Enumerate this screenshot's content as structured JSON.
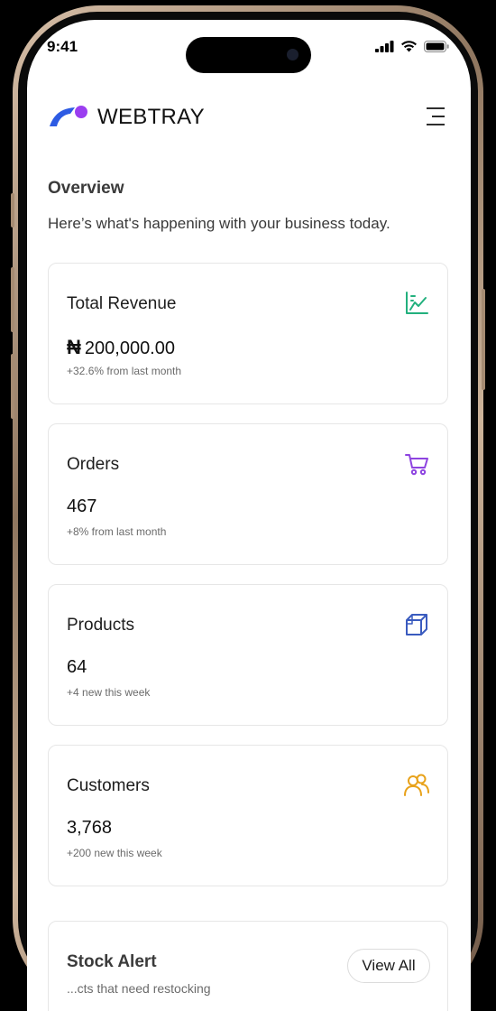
{
  "status_bar": {
    "time": "9:41"
  },
  "header": {
    "brand": "WEBTRAY"
  },
  "overview": {
    "title": "Overview",
    "subtitle": "Here’s what's happening with your business today."
  },
  "cards": [
    {
      "label": "Total Revenue",
      "currency": "₦",
      "value": "200,000.00",
      "note": "+32.6% from last month",
      "icon": "chart-line-icon",
      "icon_color": "#22b07d"
    },
    {
      "label": "Orders",
      "value": "467",
      "note": "+8% from last month",
      "icon": "shopping-cart-icon",
      "icon_color": "#8e44e0"
    },
    {
      "label": "Products",
      "value": "64",
      "note": "+4 new this week",
      "icon": "box-icon",
      "icon_color": "#3a5bbf"
    },
    {
      "label": "Customers",
      "value": "3,768",
      "note": "+200 new this week",
      "icon": "users-icon",
      "icon_color": "#e8a21a"
    }
  ],
  "stock_alert": {
    "title": "Stock Alert",
    "button": "View All",
    "subtitle": "...cts that need restocking"
  },
  "colors": {
    "logo_blue": "#2d5be3",
    "logo_purple": "#9b3ef0"
  }
}
